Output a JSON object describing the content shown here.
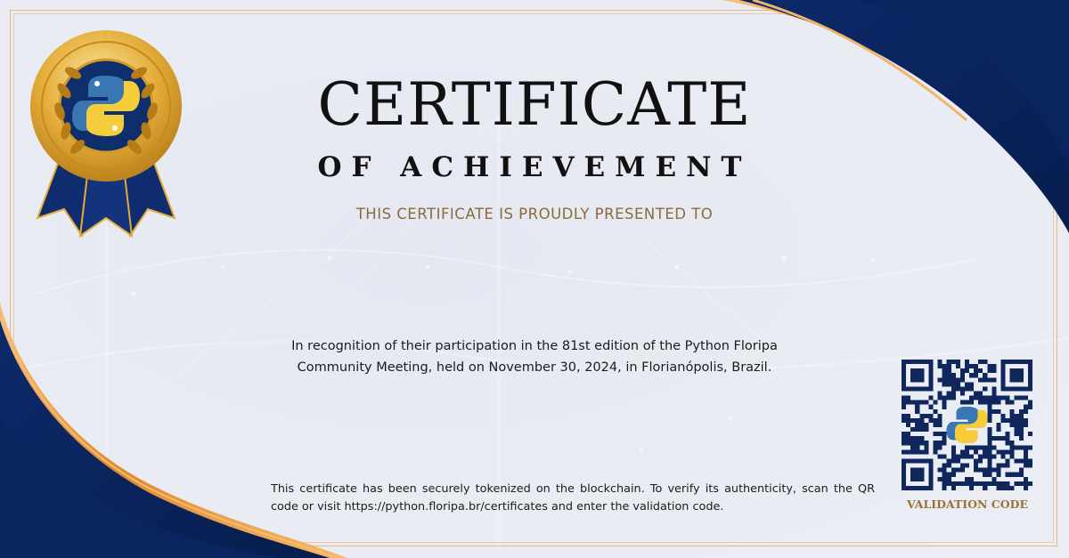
{
  "certificate": {
    "title": "CERTIFICATE",
    "subtitle": "OF ACHIEVEMENT",
    "presented_to": "THIS CERTIFICATE IS PROUDLY PRESENTED TO",
    "recipient_name": "",
    "recognition_text": "In recognition of their participation in the 81st edition of the Python Floripa Community Meeting, held on November 30, 2024, in Florianópolis, Brazil.",
    "blockchain_note": "This certificate has been securely tokenized on the blockchain. To verify its authenticity, scan the QR code or visit https://python.floripa.br/certificates and enter the validation code.",
    "validation_label": "VALIDATION CODE"
  },
  "colors": {
    "navy": "#0d2a66",
    "gold": "#e8a24a",
    "label_gold": "#9a7335",
    "text": "#111111"
  },
  "icons": {
    "medal": "python-logo-medal-icon",
    "qr": "qr-code-icon",
    "qr_center": "python-logo-icon"
  }
}
